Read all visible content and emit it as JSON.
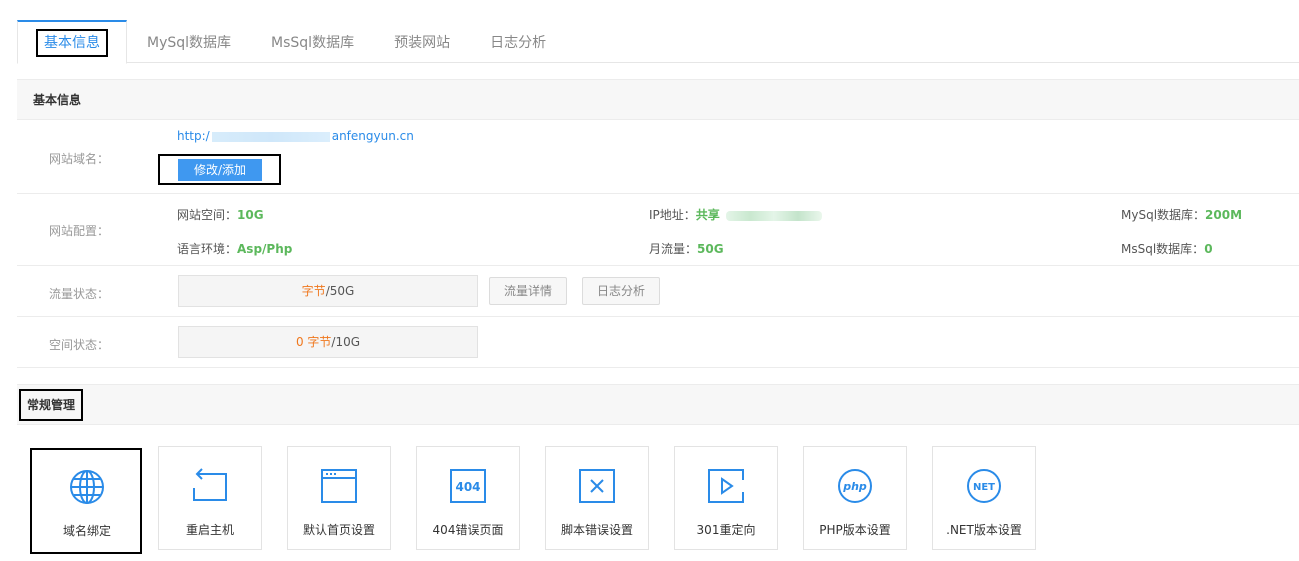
{
  "tabs": [
    {
      "label": "基本信息",
      "active": true
    },
    {
      "label": "MySql数据库"
    },
    {
      "label": "MsSql数据库"
    },
    {
      "label": "预装网站"
    },
    {
      "label": "日志分析"
    }
  ],
  "basic": {
    "section_title": "基本信息",
    "domain_label": "网站域名：",
    "domain_prefix": "http:/",
    "domain_suffix": "anfengyun.cn",
    "edit_button": "修改/添加",
    "config_label": "网站配置：",
    "space_label": "网站空间：",
    "space_value": "10G",
    "lang_label": "语言环境：",
    "lang_value": "Asp/Php",
    "ip_label": "IP地址：",
    "ip_value": "共享",
    "monthly_label": "月流量：",
    "monthly_value": "50G",
    "mysql_label": "MySql数据库：",
    "mysql_value": "200M",
    "mssql_label": "MsSql数据库：",
    "mssql_value": "0",
    "traffic_label": "流量状态：",
    "traffic_used": "字节",
    "traffic_total": "/50G",
    "traffic_detail_button": "流量详情",
    "log_button": "日志分析",
    "disk_label": "空间状态：",
    "disk_used": "0 字节",
    "disk_total": "/10G"
  },
  "manage": {
    "section_title": "常规管理",
    "tiles": [
      {
        "label": "域名绑定",
        "icon": "globe-icon"
      },
      {
        "label": "重启主机",
        "icon": "restart-icon"
      },
      {
        "label": "默认首页设置",
        "icon": "window-icon"
      },
      {
        "label": "404错误页面",
        "icon": "404-icon",
        "icon_text": "404"
      },
      {
        "label": "脚本错误设置",
        "icon": "error-x-icon"
      },
      {
        "label": "301重定向",
        "icon": "redirect-play-icon"
      },
      {
        "label": "PHP版本设置",
        "icon": "php-icon",
        "icon_text": "php"
      },
      {
        "label": ".NET版本设置",
        "icon": "dotnet-icon",
        "icon_text": "NET"
      }
    ]
  },
  "colors": {
    "accent": "#2a8be8",
    "value_green": "#5cb85c",
    "orange": "#f0781e",
    "button_blue": "#3f98f0"
  }
}
